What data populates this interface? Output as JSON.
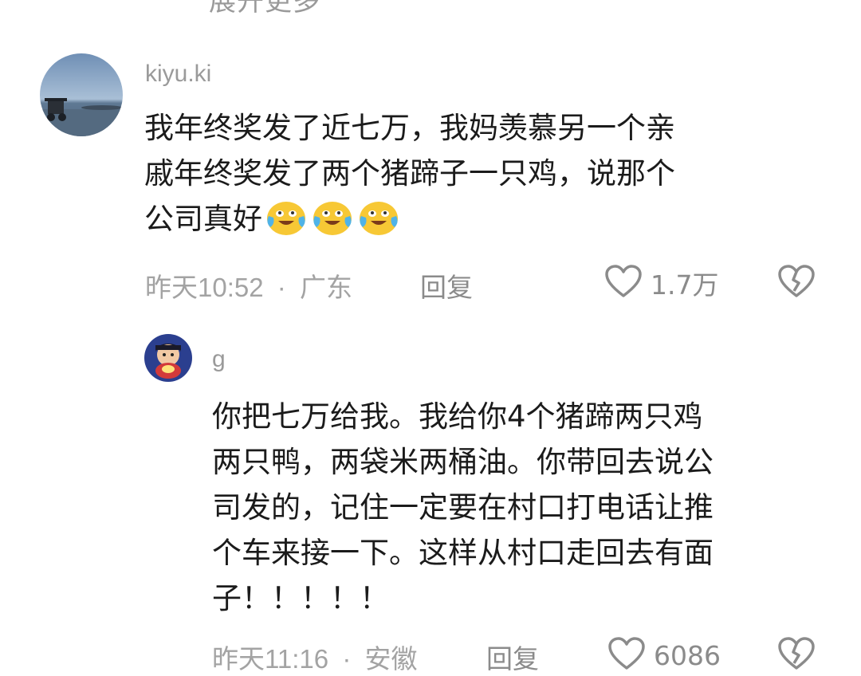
{
  "top_partial_text": "展开更多",
  "comments": [
    {
      "username": "kiyu.ki",
      "body_lines": [
        "我年终奖发了近七万，我妈羡慕另一个亲",
        "戚年终奖发了两个猪蹄子一只鸡，说那个",
        "公司真好"
      ],
      "emojis": [
        "crying-laughing-emoji",
        "crying-laughing-emoji",
        "crying-laughing-emoji"
      ],
      "time": "昨天10:52",
      "separator": "·",
      "location": "广东",
      "reply_label": "回复",
      "likes": "1.7万",
      "like_icon": "heart-outline-icon",
      "dislike_icon": "broken-heart-icon"
    },
    {
      "username": "g",
      "body_lines": [
        "你把七万给我。我给你4个猪蹄两只鸡",
        "两只鸭，两袋米两桶油。你带回去说公",
        "司发的，记住一定要在村口打电话让推",
        "个车来接一下。这样从村口走回去有面",
        "子！！！！！"
      ],
      "time": "昨天11:16",
      "separator": "·",
      "location": "安徽",
      "reply_label": "回复",
      "likes": "6086",
      "like_icon": "heart-outline-icon",
      "dislike_icon": "broken-heart-icon"
    }
  ],
  "colors": {
    "primary_text": "#1b1b1b",
    "secondary_text": "#a3a3a3",
    "action_text": "#8b8b8b",
    "emoji_face": "#f7c835"
  }
}
